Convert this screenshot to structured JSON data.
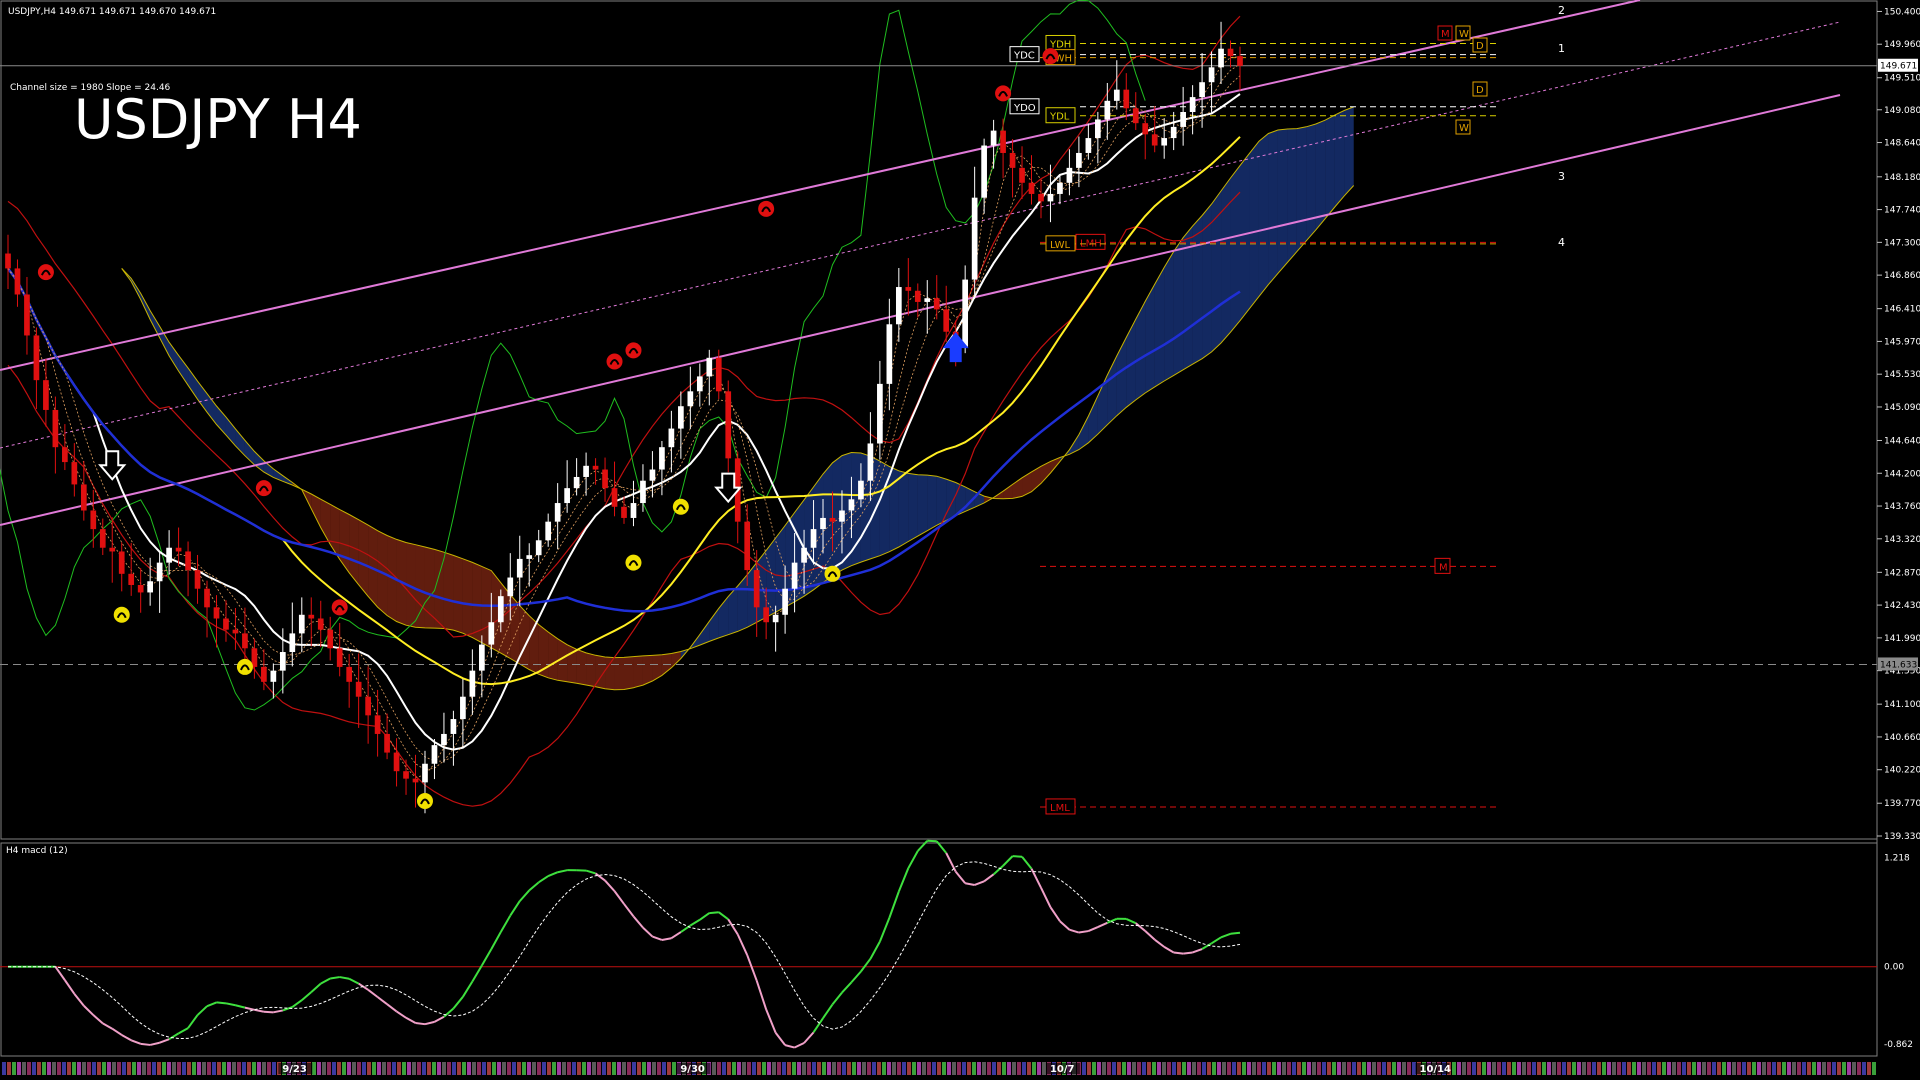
{
  "header": {
    "symbol_line": "USDJPY,H4  149.671 149.671 149.670 149.671",
    "channel_info": "Channel size = 1980 Slope = 24.46",
    "big_title": "USDJPY H4",
    "macd_label": "H4  macd (12)"
  },
  "colors": {
    "bull": "#ffffff",
    "bear": "#e01010",
    "pink": "#e07ad8",
    "white_ma": "#ffffff",
    "yellow_ma": "#ffee22",
    "blue_ma": "#1f2fd6",
    "green": "#1fbd1f",
    "red_band": "#c01010",
    "yellow_band": "#c8b400",
    "cloud_red": "#d84020",
    "cloud_blue": "#2a5bd8",
    "macd_green": "#3ee03e",
    "macd_pink": "#f0a0c8"
  },
  "chart_data": [
    {
      "type": "candlestick",
      "title": "USDJPY H4",
      "price_axis_ticks": [
        "150.400",
        "149.960",
        "149.510",
        "149.080",
        "148.640",
        "148.180",
        "147.740",
        "147.300",
        "146.860",
        "146.410",
        "145.970",
        "145.530",
        "145.090",
        "144.640",
        "144.200",
        "143.760",
        "143.320",
        "142.870",
        "142.430",
        "141.990",
        "141.550",
        "141.100",
        "140.660",
        "140.220",
        "139.770",
        "139.330"
      ],
      "ylim": [
        139.33,
        150.5
      ],
      "current_price": "149.671",
      "current_price_value": 149.671,
      "support_price": "141.633",
      "support_price_value": 141.633,
      "date_ticks": [
        {
          "label": "9/23",
          "bar": 30
        },
        {
          "label": "9/30",
          "bar": 72
        },
        {
          "label": "10/7",
          "bar": 111
        },
        {
          "label": "10/14",
          "bar": 150
        }
      ],
      "closes": [
        146.95,
        146.6,
        146.05,
        145.45,
        145.05,
        144.55,
        144.35,
        144.05,
        143.7,
        143.45,
        143.2,
        143.15,
        142.85,
        142.7,
        142.6,
        142.75,
        143.0,
        143.2,
        143.15,
        142.9,
        142.65,
        142.4,
        142.25,
        142.1,
        142.05,
        141.85,
        141.6,
        141.4,
        141.55,
        141.8,
        142.05,
        142.3,
        142.25,
        142.1,
        141.85,
        141.6,
        141.4,
        141.2,
        140.95,
        140.7,
        140.45,
        140.2,
        140.1,
        140.05,
        140.3,
        140.55,
        140.7,
        140.9,
        141.2,
        141.55,
        141.9,
        142.2,
        142.55,
        142.8,
        143.05,
        143.1,
        143.3,
        143.55,
        143.8,
        144.0,
        144.15,
        144.3,
        144.25,
        144.0,
        143.75,
        143.6,
        143.8,
        144.1,
        144.25,
        144.55,
        144.8,
        145.1,
        145.3,
        145.5,
        145.75,
        145.3,
        144.4,
        143.55,
        142.9,
        142.4,
        142.2,
        142.3,
        142.65,
        143.0,
        143.2,
        143.45,
        143.6,
        143.55,
        143.7,
        143.85,
        144.1,
        144.6,
        145.4,
        146.2,
        146.7,
        146.65,
        146.5,
        146.55,
        146.4,
        146.1,
        145.9,
        146.8,
        147.9,
        148.6,
        148.8,
        148.5,
        148.3,
        148.1,
        147.95,
        147.85,
        147.95,
        148.1,
        148.3,
        148.5,
        148.7,
        148.95,
        149.2,
        149.35,
        149.1,
        148.9,
        148.75,
        148.6,
        148.7,
        148.85,
        149.05,
        149.25,
        149.45,
        149.65,
        149.9,
        149.8,
        149.67
      ],
      "horizontal_levels": [
        {
          "label": "YDH",
          "value": 149.97,
          "color": "#d9d000"
        },
        {
          "label": "YDC",
          "value": 149.82,
          "color": "#ffffff"
        },
        {
          "label": "LWH",
          "value": 149.78,
          "color": "#e0a000"
        },
        {
          "label": "YDO",
          "value": 149.12,
          "color": "#ffffff"
        },
        {
          "label": "YDL",
          "value": 149.0,
          "color": "#d9d000"
        },
        {
          "label": "LMH",
          "value": 147.3,
          "color": "#e01010"
        },
        {
          "label": "LWL",
          "value": 147.28,
          "color": "#e0a000"
        },
        {
          "label": "M",
          "value": 142.95,
          "color": "#e01010"
        },
        {
          "label": "LML",
          "value": 139.72,
          "color": "#e01010"
        }
      ],
      "box_labels": [
        "M",
        "W",
        "D",
        "D",
        "W"
      ],
      "channel_numbers": [
        "1",
        "2",
        "3",
        "4"
      ]
    },
    {
      "type": "line",
      "title": "H4  macd (12)",
      "ticks": [
        "1.218",
        "0.00",
        "-0.862"
      ],
      "ylim": [
        -0.95,
        1.3
      ]
    }
  ]
}
